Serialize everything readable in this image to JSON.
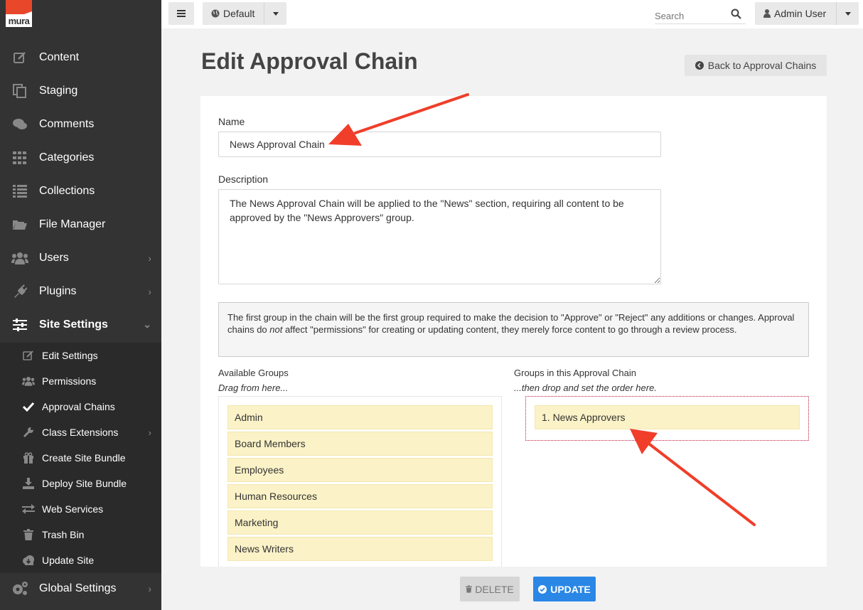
{
  "logo": {
    "text": "mura"
  },
  "sidebar": {
    "items": [
      {
        "label": "Content",
        "icon": "edit-icon"
      },
      {
        "label": "Staging",
        "icon": "copy-icon"
      },
      {
        "label": "Comments",
        "icon": "comments-icon"
      },
      {
        "label": "Categories",
        "icon": "grid-icon"
      },
      {
        "label": "Collections",
        "icon": "list-icon"
      },
      {
        "label": "File Manager",
        "icon": "folder-icon"
      },
      {
        "label": "Users",
        "icon": "users-icon"
      },
      {
        "label": "Plugins",
        "icon": "plug-icon"
      },
      {
        "label": "Site Settings",
        "icon": "sliders-icon"
      }
    ],
    "sub_items": [
      {
        "label": "Edit Settings",
        "icon": "edit-icon"
      },
      {
        "label": "Permissions",
        "icon": "users-icon"
      },
      {
        "label": "Approval Chains",
        "icon": "check-icon"
      },
      {
        "label": "Class Extensions",
        "icon": "wrench-icon"
      },
      {
        "label": "Create Site Bundle",
        "icon": "gift-icon"
      },
      {
        "label": "Deploy Site Bundle",
        "icon": "download-icon"
      },
      {
        "label": "Web Services",
        "icon": "exchange-icon"
      },
      {
        "label": "Trash Bin",
        "icon": "trash-icon"
      },
      {
        "label": "Update Site",
        "icon": "cloud-download-icon"
      }
    ],
    "global": {
      "label": "Global Settings",
      "icon": "cogs-icon"
    }
  },
  "topbar": {
    "site": "Default",
    "search_placeholder": "Search",
    "user": "Admin User"
  },
  "page": {
    "title": "Edit Approval Chain",
    "back_label": "Back to Approval Chains"
  },
  "form": {
    "name_label": "Name",
    "name_value": "News Approval Chain",
    "description_label": "Description",
    "description_value": "The News Approval Chain will be applied to the \"News\" section, requiring all content to be approved by the \"News Approvers\" group.",
    "notice_part1": "The first group in the chain will be the first group required to make the decision to \"Approve\" or \"Reject\" any additions or changes. Approval chains do ",
    "notice_em": "not",
    "notice_part2": " affect \"permissions\" for creating or updating content, they merely force content to go through a review process."
  },
  "groups": {
    "available_label": "Available Groups",
    "available_hint": "Drag from here...",
    "available": [
      "Admin",
      "Board Members",
      "Employees",
      "Human Resources",
      "Marketing",
      "News Writers"
    ],
    "chain_label": "Groups in this Approval Chain",
    "chain_hint": "...then drop and set the order here.",
    "chain": [
      "1. News Approvers"
    ]
  },
  "actions": {
    "delete_label": "DELETE",
    "update_label": "UPDATE"
  },
  "colors": {
    "sidebar": "#333333",
    "accent_orange": "#e8472a",
    "group_fill": "#fbf2c7",
    "update_blue": "#2a87e6",
    "annotation_red": "#f03e2a"
  }
}
